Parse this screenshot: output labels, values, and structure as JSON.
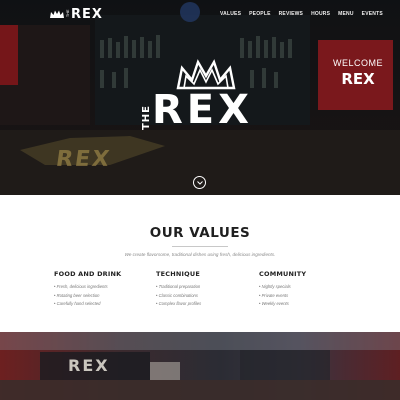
{
  "nav": {
    "logo_small": "THE",
    "logo_text": "REX",
    "links": [
      "VALUES",
      "PEOPLE",
      "REVIEWS",
      "HOURS",
      "MENU",
      "EVENTS"
    ]
  },
  "hero": {
    "logo_small": "THE",
    "logo_text": "REX",
    "sign_line1": "WELCOME",
    "sign_line2": "REX",
    "mirror_text": "REX",
    "scroll_icon": "chevron-down-icon"
  },
  "values": {
    "title": "OUR VALUES",
    "intro": "We create flavorsome, traditional dishes using fresh, delicious ingredients.",
    "columns": [
      {
        "heading": "FOOD AND DRINK",
        "items": [
          "Fresh, delicious ingredients",
          "Rotating beer selection",
          "Carefully hand selected"
        ]
      },
      {
        "heading": "TECHNIQUE",
        "items": [
          "Traditional preparation",
          "Classic combinations",
          "Complex flavor profiles"
        ]
      },
      {
        "heading": "COMMUNITY",
        "items": [
          "Nightly specials",
          "Private events",
          "Weekly events"
        ]
      }
    ]
  },
  "colors": {
    "accent": "#c9a227",
    "sign_red": "#c0262c",
    "dark": "#1f1f1f"
  }
}
